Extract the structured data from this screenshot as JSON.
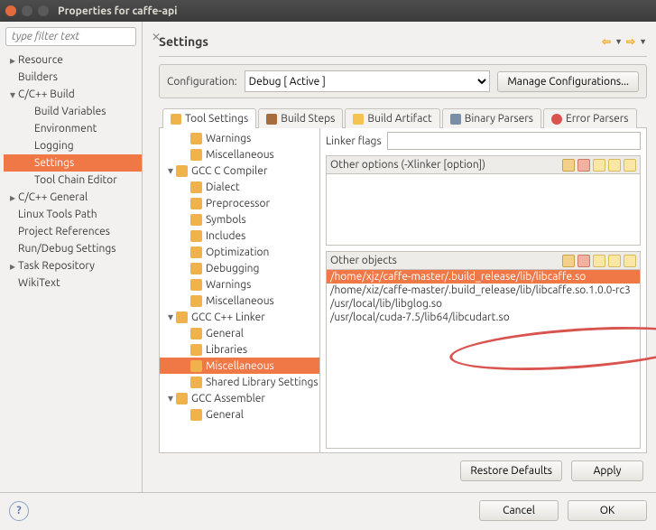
{
  "window": {
    "title": "Properties for caffe-api"
  },
  "filter": {
    "placeholder": "type filter text"
  },
  "left_tree": [
    {
      "label": "Resource",
      "depth": 1,
      "tw": "▸",
      "sel": false
    },
    {
      "label": "Builders",
      "depth": 1,
      "tw": "",
      "sel": false
    },
    {
      "label": "C/C++ Build",
      "depth": 1,
      "tw": "▾",
      "sel": false
    },
    {
      "label": "Build Variables",
      "depth": 2,
      "tw": "",
      "sel": false
    },
    {
      "label": "Environment",
      "depth": 2,
      "tw": "",
      "sel": false
    },
    {
      "label": "Logging",
      "depth": 2,
      "tw": "",
      "sel": false
    },
    {
      "label": "Settings",
      "depth": 2,
      "tw": "",
      "sel": true
    },
    {
      "label": "Tool Chain Editor",
      "depth": 2,
      "tw": "",
      "sel": false
    },
    {
      "label": "C/C++ General",
      "depth": 1,
      "tw": "▸",
      "sel": false
    },
    {
      "label": "Linux Tools Path",
      "depth": 1,
      "tw": "",
      "sel": false
    },
    {
      "label": "Project References",
      "depth": 1,
      "tw": "",
      "sel": false
    },
    {
      "label": "Run/Debug Settings",
      "depth": 1,
      "tw": "",
      "sel": false
    },
    {
      "label": "Task Repository",
      "depth": 1,
      "tw": "▸",
      "sel": false
    },
    {
      "label": "WikiText",
      "depth": 1,
      "tw": "",
      "sel": false
    }
  ],
  "settings": {
    "title": "Settings",
    "config_label": "Configuration:",
    "config_value": "Debug  [ Active ]",
    "manage_btn": "Manage Configurations..."
  },
  "tabs": [
    {
      "label": "Tool Settings",
      "icon": "ico-tool",
      "active": true
    },
    {
      "label": "Build Steps",
      "icon": "ico-steps",
      "active": false
    },
    {
      "label": "Build Artifact",
      "icon": "ico-artifact",
      "active": false
    },
    {
      "label": "Binary Parsers",
      "icon": "ico-bin",
      "active": false
    },
    {
      "label": "Error Parsers",
      "icon": "ico-err",
      "active": false
    }
  ],
  "tool_tree": [
    {
      "label": "Warnings",
      "depth": 2,
      "tw": "",
      "sel": false
    },
    {
      "label": "Miscellaneous",
      "depth": 2,
      "tw": "",
      "sel": false
    },
    {
      "label": "GCC C Compiler",
      "depth": 1,
      "tw": "▾",
      "sel": false
    },
    {
      "label": "Dialect",
      "depth": 2,
      "tw": "",
      "sel": false
    },
    {
      "label": "Preprocessor",
      "depth": 2,
      "tw": "",
      "sel": false
    },
    {
      "label": "Symbols",
      "depth": 2,
      "tw": "",
      "sel": false
    },
    {
      "label": "Includes",
      "depth": 2,
      "tw": "",
      "sel": false
    },
    {
      "label": "Optimization",
      "depth": 2,
      "tw": "",
      "sel": false
    },
    {
      "label": "Debugging",
      "depth": 2,
      "tw": "",
      "sel": false
    },
    {
      "label": "Warnings",
      "depth": 2,
      "tw": "",
      "sel": false
    },
    {
      "label": "Miscellaneous",
      "depth": 2,
      "tw": "",
      "sel": false
    },
    {
      "label": "GCC C++ Linker",
      "depth": 1,
      "tw": "▾",
      "sel": false
    },
    {
      "label": "General",
      "depth": 2,
      "tw": "",
      "sel": false
    },
    {
      "label": "Libraries",
      "depth": 2,
      "tw": "",
      "sel": false
    },
    {
      "label": "Miscellaneous",
      "depth": 2,
      "tw": "",
      "sel": true
    },
    {
      "label": "Shared Library Settings",
      "depth": 2,
      "tw": "",
      "sel": false
    },
    {
      "label": "GCC Assembler",
      "depth": 1,
      "tw": "▾",
      "sel": false
    },
    {
      "label": "General",
      "depth": 2,
      "tw": "",
      "sel": false
    }
  ],
  "linker": {
    "flags_label": "Linker flags",
    "flags_value": "",
    "other_options_label": "Other options (-Xlinker [option])",
    "other_objects_label": "Other objects",
    "objects": [
      {
        "text": "/home/xjz/caffe-master/.build_release/lib/libcaffe.so",
        "sel": true
      },
      {
        "text": "/home/xiz/caffe-master/.build_release/lib/libcaffe.so.1.0.0-rc3",
        "sel": false
      },
      {
        "text": "/usr/local/lib/libglog.so",
        "sel": false
      },
      {
        "text": "/usr/local/cuda-7.5/lib64/libcudart.so",
        "sel": false
      }
    ]
  },
  "footer": {
    "restore": "Restore Defaults",
    "apply": "Apply",
    "cancel": "Cancel",
    "ok": "OK"
  }
}
